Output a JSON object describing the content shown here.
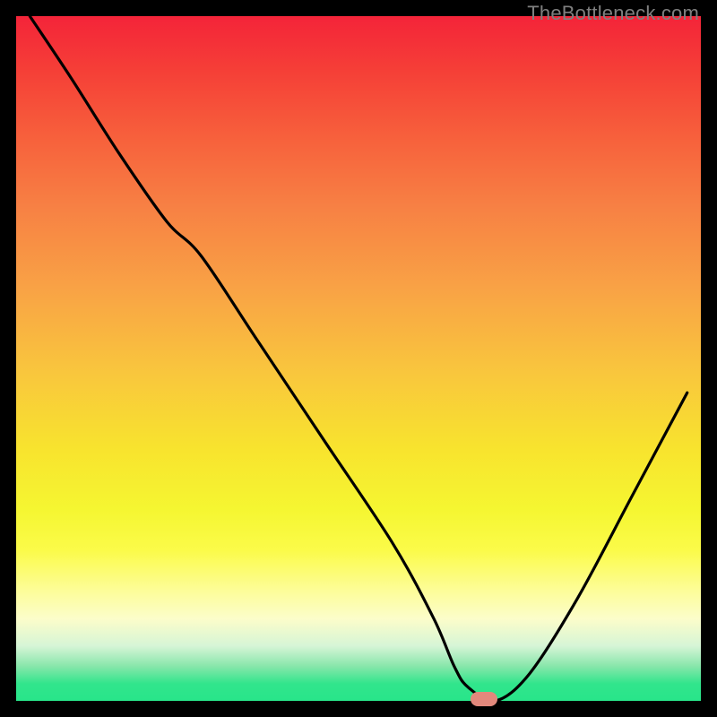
{
  "watermark": "TheBottleneck.com",
  "colors": {
    "bg": "#000000",
    "curve": "#000000",
    "marker": "#E2887C",
    "gradient_top": "#F42439",
    "gradient_bottom": "#28E58A",
    "watermark": "#7F7F7F"
  },
  "chart_data": {
    "type": "line",
    "title": "",
    "xlabel": "",
    "ylabel": "",
    "xlim": [
      0,
      100
    ],
    "ylim": [
      0,
      100
    ],
    "grid": false,
    "legend": false,
    "series": [
      {
        "name": "bottleneck-curve",
        "x": [
          2,
          8,
          15,
          22,
          27,
          35,
          45,
          55,
          61,
          64,
          66,
          70,
          75,
          82,
          90,
          98
        ],
        "y": [
          100,
          91,
          80,
          70,
          65,
          53,
          38,
          23,
          12,
          5,
          2,
          0,
          4,
          15,
          30,
          45
        ]
      }
    ],
    "marker": {
      "x": 68.3,
      "y": 0,
      "width_pct": 3.9,
      "height_pct": 2.1
    }
  }
}
